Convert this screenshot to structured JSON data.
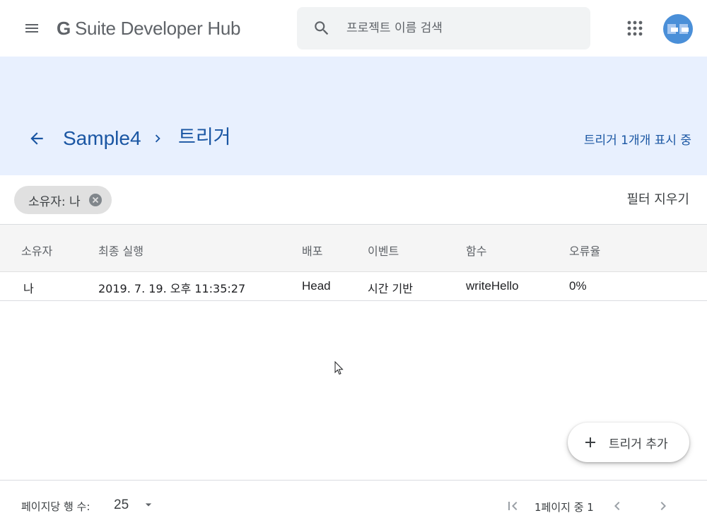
{
  "app": {
    "name_g": "G",
    "name_rest": "Suite Developer Hub"
  },
  "search": {
    "placeholder": "프로젝트 이름 검색"
  },
  "breadcrumb": {
    "project": "Sample4",
    "current": "트리거"
  },
  "header": {
    "count_text": "트리거 1개개 표시 중"
  },
  "filter": {
    "chip_label": "소유자: 나",
    "clear_label": "필터 지우기"
  },
  "table": {
    "columns": [
      "소유자",
      "최종 실행",
      "배포",
      "이벤트",
      "함수",
      "오류율"
    ],
    "rows": [
      {
        "owner": "나",
        "last_run": "2019. 7. 19. 오후 11:35:27",
        "deployment": "Head",
        "event": "시간 기반",
        "function": "writeHello",
        "error_rate": "0%"
      }
    ]
  },
  "fab": {
    "label": "트리거 추가"
  },
  "pagination": {
    "rows_per_page_label": "페이지당 행 수:",
    "rows_per_page_value": "25",
    "page_info": "1페이지 중 1"
  },
  "colors": {
    "accent": "#1a56a3",
    "band": "#e8f0fe",
    "avatar": "#4a8fd8"
  },
  "icons": [
    "menu-icon",
    "search-icon",
    "apps-icon",
    "arrow-back-icon",
    "chevron-right-icon",
    "cancel-icon",
    "add-icon",
    "dropdown-icon",
    "first-page-icon",
    "chevron-left-icon",
    "chevron-right-icon"
  ]
}
